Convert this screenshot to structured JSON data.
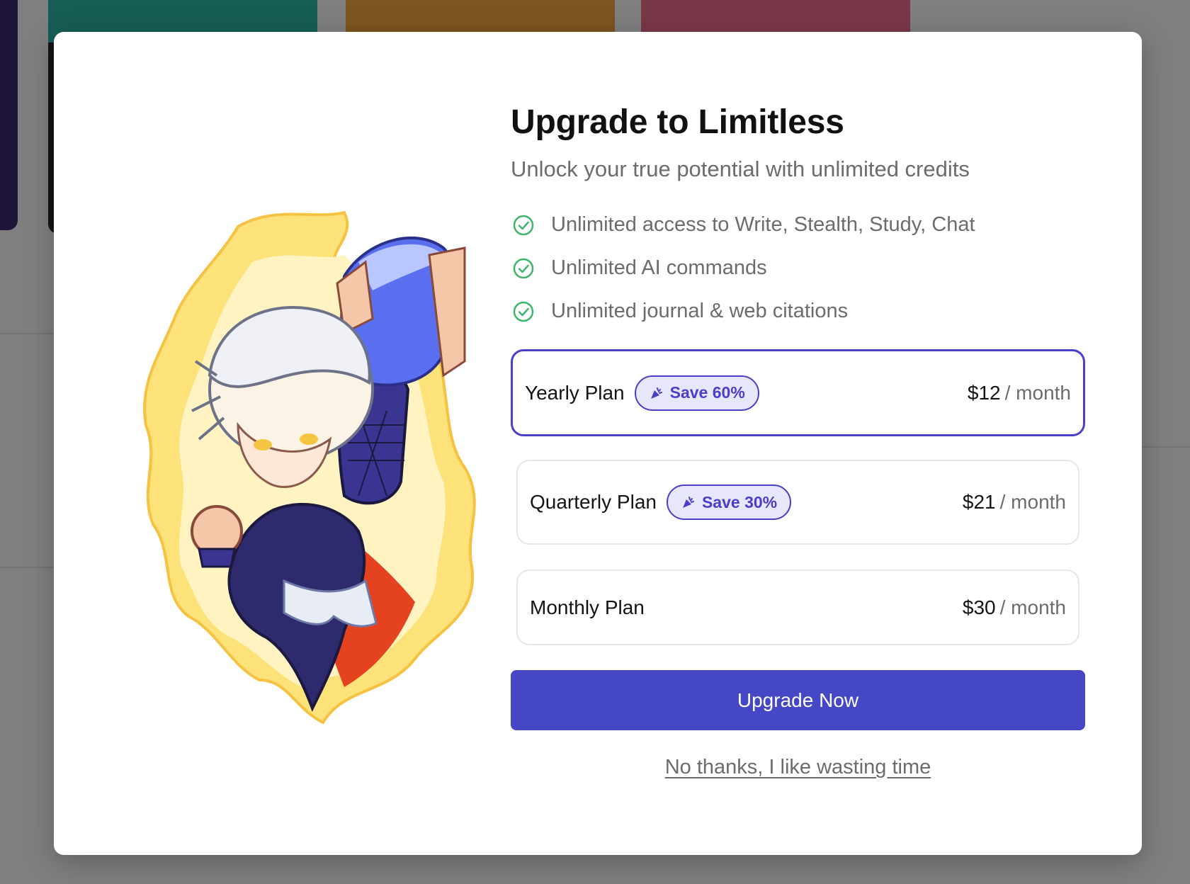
{
  "modal": {
    "title": "Upgrade to Limitless",
    "subtitle": "Unlock your true potential with unlimited credits",
    "features": [
      "Unlimited access to Write, Stealth, Study, Chat",
      "Unlimited AI commands",
      "Unlimited journal & web citations"
    ],
    "plans": [
      {
        "name": "Yearly Plan",
        "badge": "Save 60%",
        "price": "$12",
        "period": "/ month",
        "selected": true
      },
      {
        "name": "Quarterly Plan",
        "badge": "Save 30%",
        "price": "$21",
        "period": "/ month",
        "selected": false
      },
      {
        "name": "Monthly Plan",
        "badge": "",
        "price": "$30",
        "period": "/ month",
        "selected": false
      }
    ],
    "upgrade_label": "Upgrade Now",
    "decline_label": "No thanks, I like wasting time",
    "illustration": "flaming-hero-character",
    "icons": {
      "feature": "check-circle-icon",
      "badge": "party-popper-icon"
    }
  },
  "colors": {
    "accent": "#4547c4",
    "selected_border": "#4a3fc7",
    "badge_bg": "#e8e6fb",
    "check": "#3fb56b",
    "overlay": "rgba(0,0,0,0.48)"
  }
}
